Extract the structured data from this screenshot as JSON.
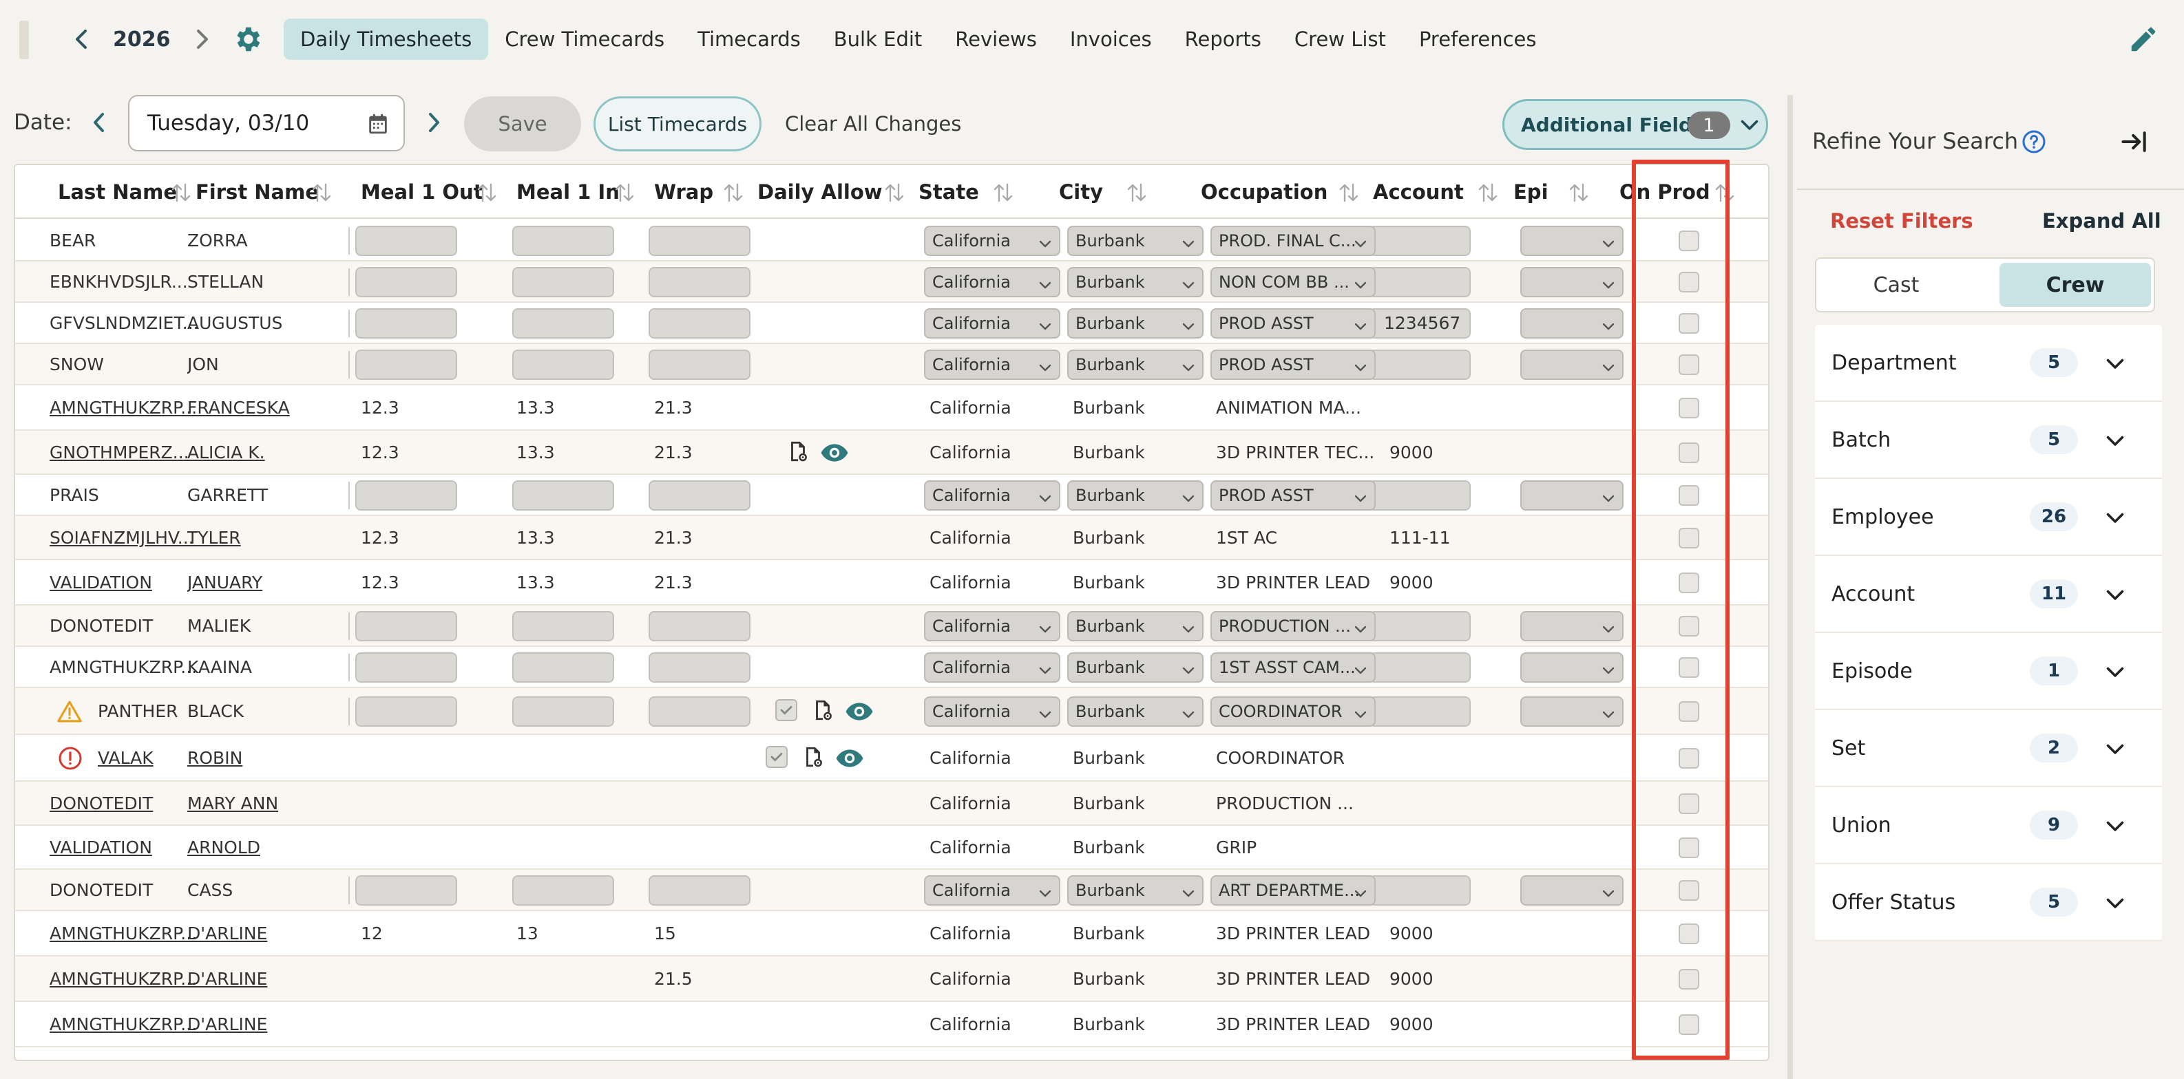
{
  "header": {
    "year": "2026",
    "tabs": [
      "Daily Timesheets",
      "Crew Timecards",
      "Timecards",
      "Bulk Edit",
      "Reviews",
      "Invoices",
      "Reports",
      "Crew List",
      "Preferences"
    ],
    "active_tab": "Daily Timesheets",
    "icons": {
      "prev": "chevron-left-icon",
      "next": "chevron-right-icon",
      "settings": "gear-icon",
      "edit": "pencil-icon"
    }
  },
  "toolbar": {
    "date_label": "Date:",
    "date_value": "Tuesday, 03/10",
    "save_label": "Save",
    "list_label": "List Timecards",
    "clear_label": "Clear All Changes",
    "additional_label": "Additional Fields",
    "additional_count": "1"
  },
  "table": {
    "columns": [
      "Last Name",
      "First Name",
      "Meal 1 Out",
      "Meal 1 In",
      "Wrap",
      "Daily Allow",
      "State",
      "City",
      "Occupation",
      "Account",
      "Epi",
      "On Prod"
    ],
    "rows": [
      {
        "last": "BEAR",
        "first": "ZORRA",
        "link": false,
        "edit": true,
        "meal_out": "",
        "meal_in": "",
        "wrap": "",
        "state": "California",
        "city": "Burbank",
        "occ": "PROD. FINAL C...",
        "account": "",
        "alert": "",
        "allow": ""
      },
      {
        "last": "EBNKHVDSJLR...",
        "first": "STELLAN",
        "link": false,
        "edit": true,
        "meal_out": "",
        "meal_in": "",
        "wrap": "",
        "state": "California",
        "city": "Burbank",
        "occ": "NON COM BB ...",
        "account": "",
        "alert": "",
        "allow": ""
      },
      {
        "last": "GFVSLNDMZIET...",
        "first": "AUGUSTUS",
        "link": false,
        "edit": true,
        "meal_out": "",
        "meal_in": "",
        "wrap": "",
        "state": "California",
        "city": "Burbank",
        "occ": "PROD ASST",
        "account": "1234567",
        "alert": "",
        "allow": ""
      },
      {
        "last": "SNOW",
        "first": "JON",
        "link": false,
        "edit": true,
        "meal_out": "",
        "meal_in": "",
        "wrap": "",
        "state": "California",
        "city": "Burbank",
        "occ": "PROD ASST",
        "account": "",
        "alert": "",
        "allow": ""
      },
      {
        "last": "AMNGTHUKZRP...",
        "first": "FRANCESKA",
        "link": true,
        "edit": false,
        "meal_out": "12.3",
        "meal_in": "13.3",
        "wrap": "21.3",
        "state": "California",
        "city": "Burbank",
        "occ": "ANIMATION MA...",
        "account": "",
        "alert": "",
        "allow": ""
      },
      {
        "last": "GNOTHMPERZ...",
        "first": "ALICIA K.",
        "link": true,
        "edit": false,
        "meal_out": "12.3",
        "meal_in": "13.3",
        "wrap": "21.3",
        "state": "California",
        "city": "Burbank",
        "occ": "3D PRINTER TEC...",
        "account": "9000",
        "alert": "",
        "allow": "icons"
      },
      {
        "last": "PRAIS",
        "first": "GARRETT",
        "link": false,
        "edit": true,
        "meal_out": "",
        "meal_in": "",
        "wrap": "",
        "state": "California",
        "city": "Burbank",
        "occ": "PROD ASST",
        "account": "",
        "alert": "",
        "allow": ""
      },
      {
        "last": "SOIAFNZMJLHV...",
        "first": "TYLER",
        "link": true,
        "edit": false,
        "meal_out": "12.3",
        "meal_in": "13.3",
        "wrap": "21.3",
        "state": "California",
        "city": "Burbank",
        "occ": "1ST AC",
        "account": "111-11",
        "alert": "",
        "allow": ""
      },
      {
        "last": "VALIDATION",
        "first": "JANUARY",
        "link": true,
        "edit": false,
        "meal_out": "12.3",
        "meal_in": "13.3",
        "wrap": "21.3",
        "state": "California",
        "city": "Burbank",
        "occ": "3D PRINTER LEAD",
        "account": "9000",
        "alert": "",
        "allow": ""
      },
      {
        "last": "DONOTEDIT",
        "first": "MALIEK",
        "link": false,
        "edit": true,
        "meal_out": "",
        "meal_in": "",
        "wrap": "",
        "state": "California",
        "city": "Burbank",
        "occ": "PRODUCTION ...",
        "account": "",
        "alert": "",
        "allow": ""
      },
      {
        "last": "AMNGTHUKZRP...",
        "first": "KAAINA",
        "link": false,
        "edit": true,
        "meal_out": "",
        "meal_in": "",
        "wrap": "",
        "state": "California",
        "city": "Burbank",
        "occ": "1ST ASST CAM...",
        "account": "",
        "alert": "",
        "allow": ""
      },
      {
        "last": "PANTHER",
        "first": "BLACK",
        "link": false,
        "edit": true,
        "meal_out": "",
        "meal_in": "",
        "wrap": "",
        "state": "California",
        "city": "Burbank",
        "occ": "COORDINATOR",
        "account": "",
        "alert": "warning",
        "allow": "check"
      },
      {
        "last": "VALAK",
        "first": "ROBIN",
        "link": true,
        "edit": false,
        "meal_out": "",
        "meal_in": "",
        "wrap": "",
        "state": "California",
        "city": "Burbank",
        "occ": "COORDINATOR",
        "account": "",
        "alert": "error",
        "allow": "check"
      },
      {
        "last": "DONOTEDIT",
        "first": "MARY ANN",
        "link": true,
        "edit": false,
        "meal_out": "",
        "meal_in": "",
        "wrap": "",
        "state": "California",
        "city": "Burbank",
        "occ": "PRODUCTION ...",
        "account": "",
        "alert": "",
        "allow": ""
      },
      {
        "last": "VALIDATION",
        "first": "ARNOLD",
        "link": true,
        "edit": false,
        "meal_out": "",
        "meal_in": "",
        "wrap": "",
        "state": "California",
        "city": "Burbank",
        "occ": "GRIP",
        "account": "",
        "alert": "",
        "allow": ""
      },
      {
        "last": "DONOTEDIT",
        "first": "CASS",
        "link": false,
        "edit": true,
        "meal_out": "",
        "meal_in": "",
        "wrap": "",
        "state": "California",
        "city": "Burbank",
        "occ": "ART DEPARTME...",
        "account": "",
        "alert": "",
        "allow": ""
      },
      {
        "last": "AMNGTHUKZRP...",
        "first": "D'ARLINE",
        "link": true,
        "edit": false,
        "meal_out": "12",
        "meal_in": "13",
        "wrap": "15",
        "state": "California",
        "city": "Burbank",
        "occ": "3D PRINTER LEAD",
        "account": "9000",
        "alert": "",
        "allow": ""
      },
      {
        "last": "AMNGTHUKZRP...",
        "first": "D'ARLINE",
        "link": true,
        "edit": false,
        "meal_out": "",
        "meal_in": "",
        "wrap": "21.5",
        "state": "California",
        "city": "Burbank",
        "occ": "3D PRINTER LEAD",
        "account": "9000",
        "alert": "",
        "allow": ""
      },
      {
        "last": "AMNGTHUKZRP...",
        "first": "D'ARLINE",
        "link": true,
        "edit": false,
        "meal_out": "",
        "meal_in": "",
        "wrap": "",
        "state": "California",
        "city": "Burbank",
        "occ": "3D PRINTER LEAD",
        "account": "9000",
        "alert": "",
        "allow": ""
      }
    ]
  },
  "sidebar": {
    "title": "Refine Your Search",
    "reset_label": "Reset Filters",
    "expand_label": "Expand All",
    "segments": [
      "Cast",
      "Crew"
    ],
    "active_segment": "Crew",
    "facets": [
      {
        "label": "Department",
        "count": "5"
      },
      {
        "label": "Batch",
        "count": "5"
      },
      {
        "label": "Employee",
        "count": "26"
      },
      {
        "label": "Account",
        "count": "11"
      },
      {
        "label": "Episode",
        "count": "1"
      },
      {
        "label": "Set",
        "count": "2"
      },
      {
        "label": "Union",
        "count": "9"
      },
      {
        "label": "Offer Status",
        "count": "5"
      }
    ]
  },
  "colors": {
    "accent": "#2f7a7c",
    "active_tab_bg": "#c9e2e3",
    "highlight": "#e2412f",
    "reset": "#d0463a"
  }
}
